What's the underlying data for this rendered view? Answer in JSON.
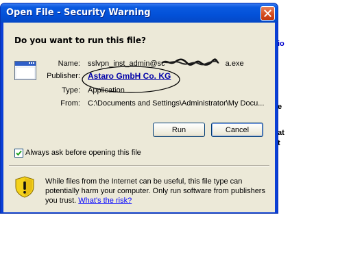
{
  "dialog": {
    "title": "Open File - Security Warning",
    "question": "Do you want to run this file?"
  },
  "details": {
    "name_label": "Name:",
    "name_value": "sslvpn_inst_admin@sc",
    "name_suffix": "a.exe",
    "publisher_label": "Publisher:",
    "publisher_value": "Astaro GmbH  Co. KG",
    "type_label": "Type:",
    "type_value": "Application",
    "from_label": "From:",
    "from_value": "C:\\Documents and Settings\\Administrator\\My Docu..."
  },
  "buttons": {
    "run": "Run",
    "cancel": "Cancel"
  },
  "checkbox": {
    "label": "Always ask before opening this file",
    "checked": true
  },
  "warning": {
    "text": "While files from the Internet can be useful, this file type can potentially harm your computer. Only run software from publishers you trust. ",
    "link": "What's the risk?"
  },
  "background": {
    "fragment_a": "io",
    "fragment_b": "e",
    "fragment_c": "at",
    "fragment_d": "t"
  },
  "colors": {
    "title_bar": "#0351d8",
    "client": "#ece9d8",
    "link": "#0000ff",
    "publisher": "#0000a8",
    "annotation": "#000000"
  }
}
